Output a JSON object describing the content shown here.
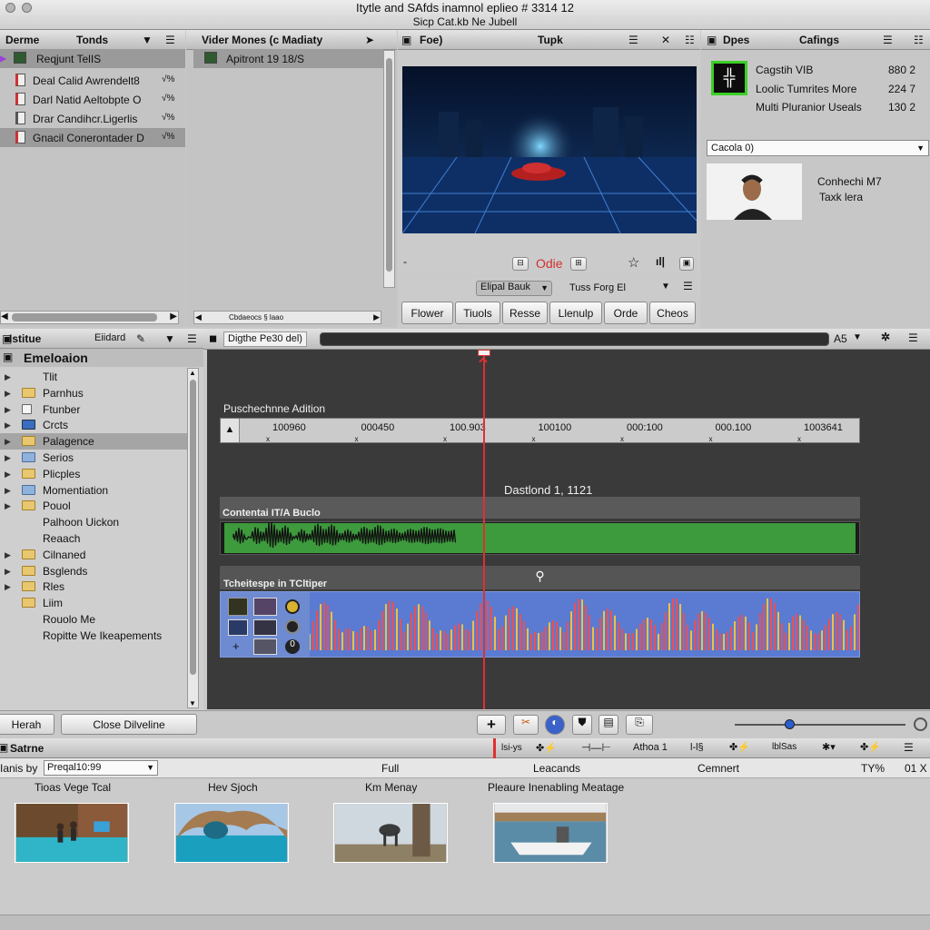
{
  "window": {
    "title": "Itytle and SAfds inamnol eplieo # 3314 12",
    "subtitle": "Sicp Cat.kb Ne Jubell"
  },
  "browser": {
    "col1": "Derme",
    "col2": "Tonds",
    "items": [
      "Reqjunt TelIS",
      "Deal Calid Awrendelt8",
      "Darl Natid Aeltobpte O",
      "Drar Candihcr.Ligerlis",
      "Gnacil Conerontader D"
    ],
    "item_tags": [
      "",
      "√%",
      "√%",
      "√%",
      "√%"
    ]
  },
  "library": {
    "title": "Vider Mones (c Madiaty",
    "item": "Apitront 19 18/S",
    "scroll_label": "Cbdaeocs § laao"
  },
  "viewer": {
    "left": "Foe)",
    "title": "Tupk",
    "timecode_label": "Odie"
  },
  "effects": {
    "select_value": "Elipal Bauk",
    "font_label": "Tuss Forg El",
    "buttons": [
      "Flower",
      "Tiuols",
      "Resse",
      "Llenulp",
      "Orde",
      "Cheos"
    ]
  },
  "inspector": {
    "col1": "Dpes",
    "col2": "Cafings",
    "items": [
      {
        "label": "Cagstih VIB",
        "value": "880 2"
      },
      {
        "label": "Loolic Tumrites More",
        "value": "224 7"
      },
      {
        "label": "Multi Pluranior Useals",
        "value": "130 2"
      }
    ],
    "select_value": "Cacola 0)",
    "thumb_label1": "Conhechi M7",
    "thumb_label2": "Taxk lera"
  },
  "sidebar": {
    "title": "Istitue",
    "badge": "Eiidard",
    "section": "Emeloaion",
    "items": [
      "Tlit",
      "Parnhus",
      "Ftunber",
      "Crcts",
      "Palagence",
      "Serios",
      "Plicples",
      "Momentiation",
      "Pouol",
      "Palhoon Uickon",
      "Reaach",
      "Cilnaned",
      "Bsglends",
      "Rles",
      "Liim",
      "Rouolo Me",
      "Ropitte We Ikeapements"
    ],
    "bottom_left": "Herah",
    "bottom_right": "Close Dilveline"
  },
  "timeline": {
    "sequence": "Digthe Pe30 del)",
    "zoom_label": "A5",
    "ruler_title": "Puschechnne Adition",
    "ticks": [
      "100960",
      "000450",
      "100.903",
      "100100",
      "000:100",
      "000.100",
      "1003641"
    ],
    "track_title": "Dastlond 1, 1121",
    "audio_track": "Contentai IT/A Buclo",
    "video_track": "Tcheitespe in TCltiper"
  },
  "bottom": {
    "title": "Satrne",
    "sort_label": "Ianis by",
    "sort_value": "Preqal10:99",
    "columns": [
      "Full",
      "Leacands",
      "Cemnert"
    ],
    "right_label1": "TY%",
    "right_label2": "01 X",
    "toolbar_labels": [
      "lsi-ys",
      "Athoa 1",
      "l-l§",
      "lblSas"
    ],
    "clips": [
      "Tioas Vege Tcal",
      "Hev Sjoch",
      "Km Menay",
      "Pleaure Inenabling Meatage"
    ]
  },
  "colors": {
    "audio_wave": "#3d9a3d",
    "video_wave": "#5b7fd1",
    "playhead": "#e03030",
    "accent_green": "#3ccf28"
  }
}
